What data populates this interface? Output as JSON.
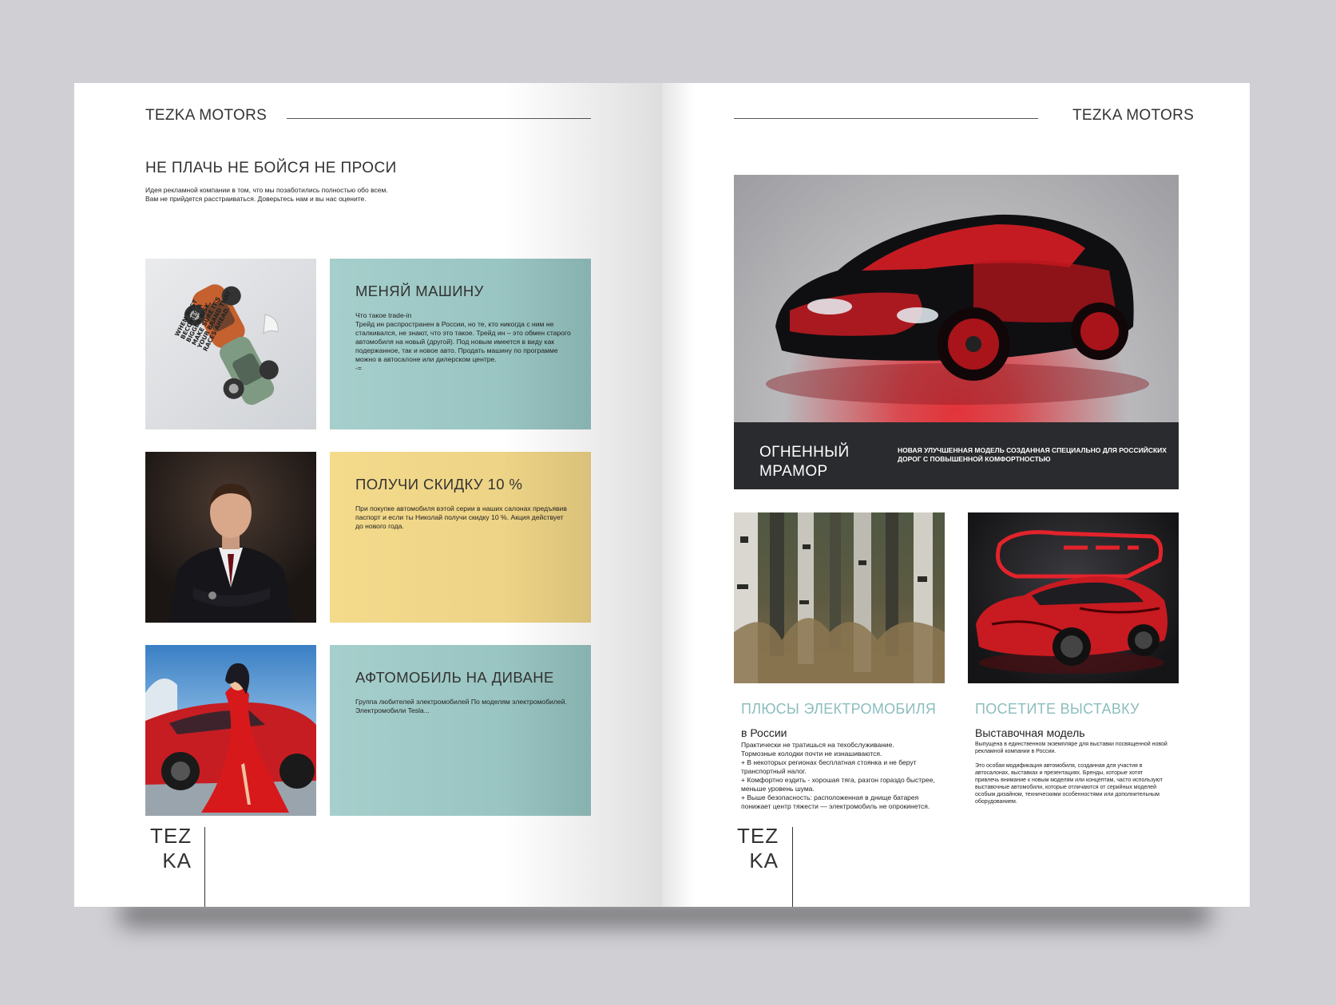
{
  "brand": "TEZKA MOTORS",
  "left": {
    "headline": "НЕ ПЛАЧЬ НЕ БОЙСЯ НЕ ПРОСИ",
    "intro": [
      "Идея рекламной компании в том, что мы позаботились полностью обо всем.",
      "Вам не прийдется расстраиваться. Доверьтесь нам  и вы нас оцените."
    ],
    "cards": [
      {
        "title": "МЕНЯЙ  МАШИНУ",
        "lines": [
          "Что такое trade-in",
          "Трейд ин распространен в России, но те, кто никогда с ним не",
          "сталкивался, не знают, что это такое. Трейд ин – это обмен старого",
          "автомобиля на новый (другой). Под новым имеется в виду как",
          "подержанное, так и новое авто. Продать машину по программе",
          "можно в автосалоне или дилерском центре.",
          "-="
        ]
      },
      {
        "title": "ПОЛУЧИ СКИДКУ 10 %",
        "lines": [
          "При покупке автомобиля вэтой серии в наших салонах предъявив",
          "паспорт и если ты Николай получи скидку 10 %. Акция действует",
          "до нового года."
        ]
      },
      {
        "title": "АФТОМОБИЛЬ НА ДИВАНЕ",
        "lines": [
          "Группа  любителей электромобилей По моделям электромобилей.",
          "Электромобили Tesla..."
        ]
      }
    ],
    "poster_text": [
      "WHEN RUST",
      "BECOMES A",
      "BIGGER RISK,",
      "MAKE SURE IT'S",
      "YOUR BRAND THAT",
      "RACES AHEAD."
    ],
    "tezka": [
      "TEZ",
      "KA"
    ]
  },
  "right": {
    "hero_caption_title": [
      "ОГНЕННЫЙ",
      "МРАМОР"
    ],
    "hero_caption_text": [
      "НОВАЯ УЛУЧШЕННАЯ МОДЕЛЬ СОЗДАННАЯ СПЕЦИАЛЬНО ДЛЯ  РОССИЙСКИХ",
      "ДОРОГ С ПОВЫШЕННОЙ КОМФОРТНОСТЬЮ"
    ],
    "col1": {
      "title": "ПЛЮСЫ ЭЛЕКТРОМОБИЛЯ",
      "subtitle": "в России",
      "lines": [
        "Практически не тратишься на техобслуживание.",
        "Тормозные колодки почти не изнашиваются.",
        "+ В некоторых регионах бесплатная стоянка и не берут",
        "транспортный налог.",
        "+ Комфортно ездить - хорошая тяга, разгон гораздо быстрее,",
        "меньше уровень шума.",
        "+ Выше безопасность: расположенная в днище батарея",
        "понижает центр тяжести — электромобиль не опрокинется."
      ]
    },
    "col2": {
      "title": "ПОСЕТИТЕ ВЫСТАВКУ",
      "subtitle": "Выставочная модель",
      "lines1": [
        "Выпущена в единственном экземпляре для выставки посвященной новой",
        "рекламной компании в России."
      ],
      "lines2": [
        "Это особая модификация автомобиля, созданная для участия в",
        "автосалонах, выставках и презентациях. Бренды, которые хотят",
        "привлечь внимание к новым моделям или концептам, часто используют",
        "выставочные автомобили, которые отличаются от серийных моделей",
        "особым дизайном, техническими особенностями или дополнительным",
        "оборудованием."
      ]
    },
    "tezka": [
      "TEZ",
      "KA"
    ]
  }
}
